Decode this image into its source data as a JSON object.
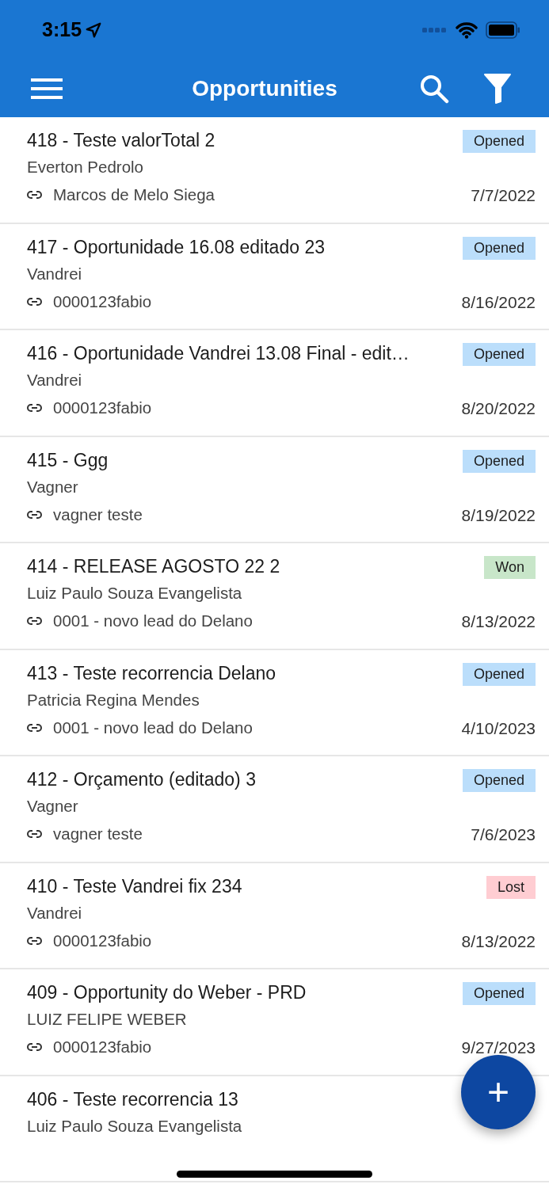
{
  "status_bar": {
    "time": "3:15"
  },
  "toolbar": {
    "title": "Opportunities"
  },
  "opportunities": [
    {
      "title": "418 - Teste valorTotal 2",
      "owner": "Everton Pedrolo",
      "link": "Marcos de Melo Siega",
      "date": "7/7/2022",
      "status": {
        "kind": "opened",
        "label": "Opened"
      }
    },
    {
      "title": "417 - Oportunidade 16.08 editado 23",
      "owner": "Vandrei",
      "link": "0000123fabio",
      "date": "8/16/2022",
      "status": {
        "kind": "opened",
        "label": "Opened"
      }
    },
    {
      "title": "416 - Oportunidade Vandrei 13.08 Final - edit…",
      "owner": "Vandrei",
      "link": "0000123fabio",
      "date": "8/20/2022",
      "status": {
        "kind": "opened",
        "label": "Opened"
      }
    },
    {
      "title": "415 - Ggg",
      "owner": "Vagner",
      "link": "vagner teste",
      "date": "8/19/2022",
      "status": {
        "kind": "opened",
        "label": "Opened"
      }
    },
    {
      "title": "414 - RELEASE AGOSTO 22 2",
      "owner": "Luiz Paulo Souza Evangelista",
      "link": "0001 - novo lead do Delano",
      "date": "8/13/2022",
      "status": {
        "kind": "won",
        "label": "Won"
      }
    },
    {
      "title": "413 - Teste recorrencia Delano",
      "owner": "Patricia Regina Mendes",
      "link": "0001 - novo lead do Delano",
      "date": "4/10/2023",
      "status": {
        "kind": "opened",
        "label": "Opened"
      }
    },
    {
      "title": "412 - Orçamento (editado) 3",
      "owner": "Vagner",
      "link": "vagner teste",
      "date": "7/6/2023",
      "status": {
        "kind": "opened",
        "label": "Opened"
      }
    },
    {
      "title": "410 - Teste Vandrei fix 234",
      "owner": "Vandrei",
      "link": "0000123fabio",
      "date": "8/13/2022",
      "status": {
        "kind": "lost",
        "label": "Lost"
      }
    },
    {
      "title": "409 - Opportunity do Weber - PRD",
      "owner": "LUIZ FELIPE WEBER",
      "link": "0000123fabio",
      "date": "9/27/2023",
      "status": {
        "kind": "opened",
        "label": "Opened"
      }
    },
    {
      "title": "406 - Teste recorrencia 13",
      "owner": "Luiz Paulo Souza Evangelista"
    }
  ],
  "fab": {
    "label": "+"
  }
}
